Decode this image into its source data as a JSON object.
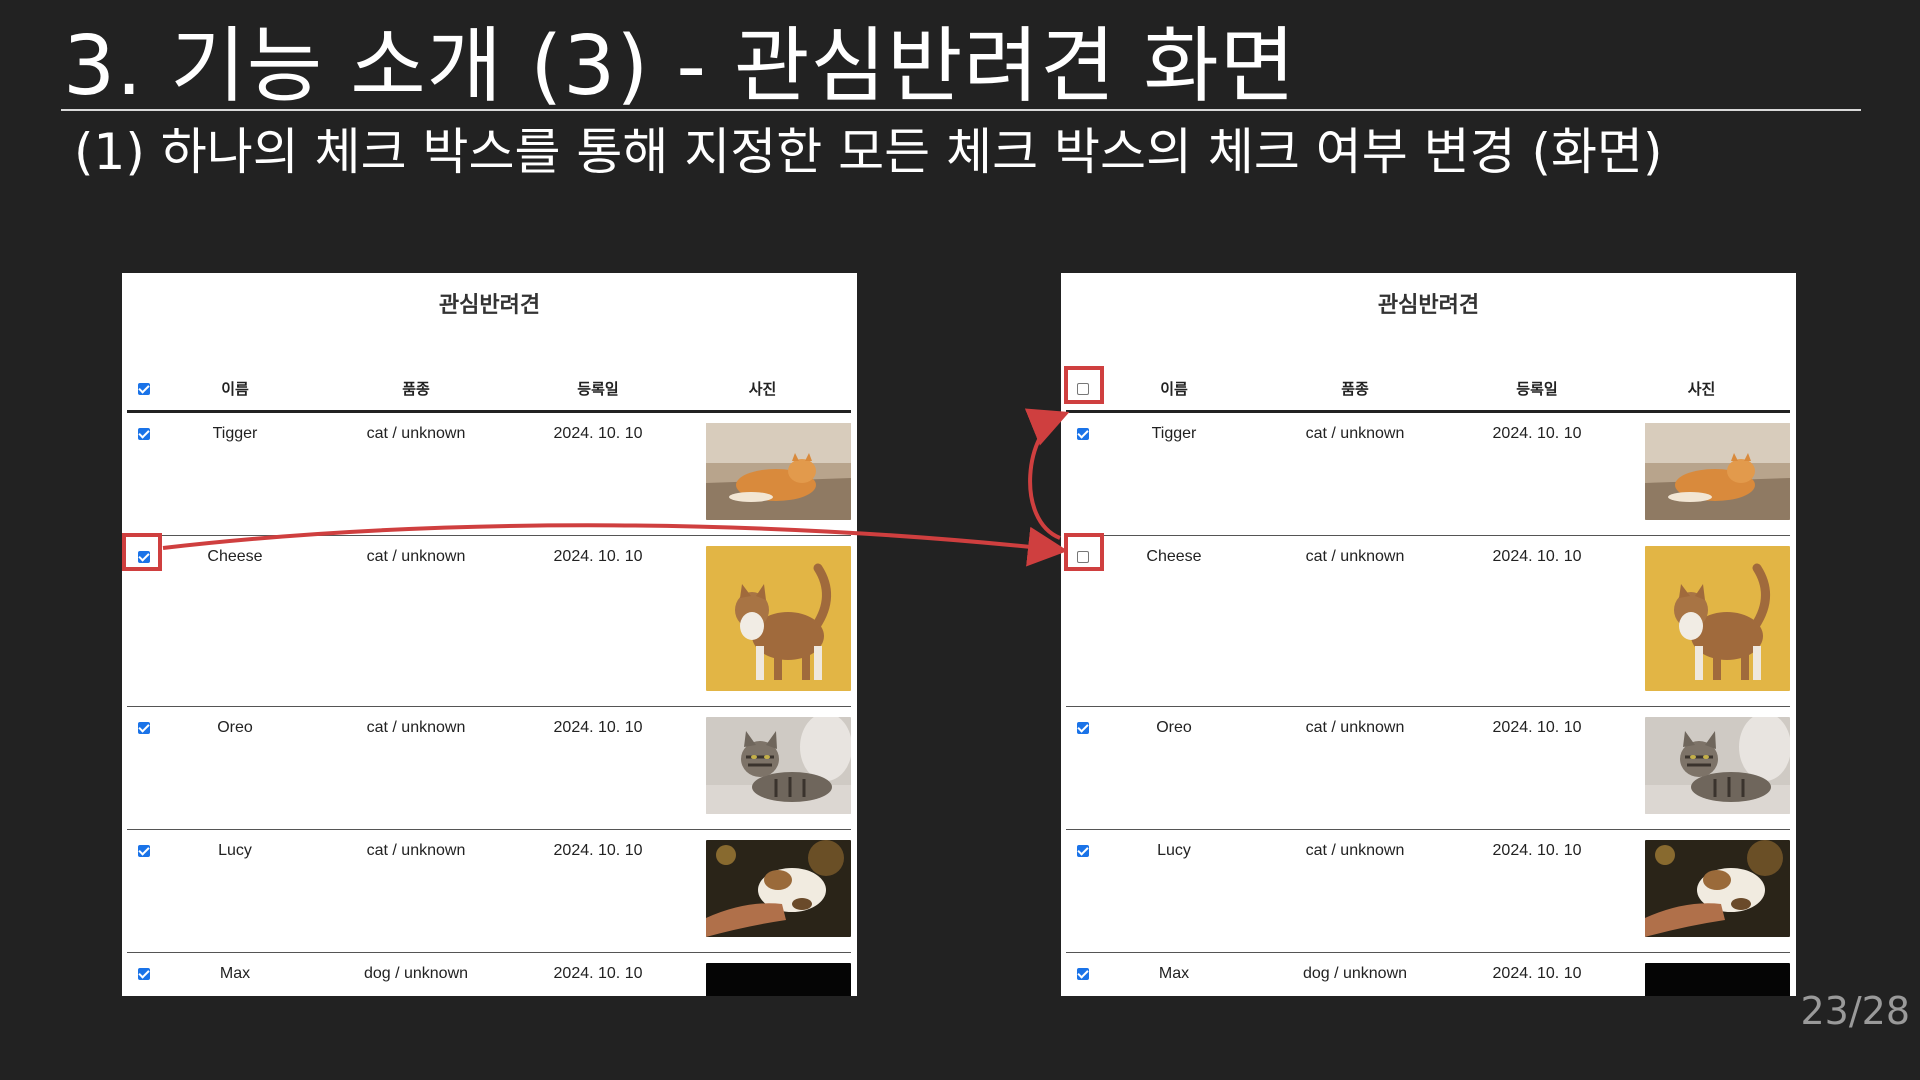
{
  "slide": {
    "title": "3. 기능 소개 (3) - 관심반려견 화면",
    "subtitle": "(1) 하나의 체크 박스를 통해 지정한 모든 체크 박스의 체크 여부 변경 (화면)",
    "page_number": "23/28"
  },
  "left_screen": {
    "title": "관심반려견",
    "headers": {
      "name": "이름",
      "breed": "품종",
      "date": "등록일",
      "photo": "사진"
    },
    "header_checked": true,
    "rows": [
      {
        "checked": true,
        "name": "Tigger",
        "breed": "cat / unknown",
        "date": "2024. 10. 10",
        "photo": "orange-cat-lying-photo"
      },
      {
        "checked": true,
        "name": "Cheese",
        "breed": "cat / unknown",
        "date": "2024. 10. 10",
        "photo": "orange-cat-standing-photo"
      },
      {
        "checked": true,
        "name": "Oreo",
        "breed": "cat / unknown",
        "date": "2024. 10. 10",
        "photo": "tabby-cat-on-sofa-photo"
      },
      {
        "checked": true,
        "name": "Lucy",
        "breed": "cat / unknown",
        "date": "2024. 10. 10",
        "photo": "cat-with-hand-photo"
      },
      {
        "checked": true,
        "name": "Max",
        "breed": "dog / unknown",
        "date": "2024. 10. 10",
        "photo": "dark-photo"
      }
    ]
  },
  "right_screen": {
    "title": "관심반려견",
    "headers": {
      "name": "이름",
      "breed": "품종",
      "date": "등록일",
      "photo": "사진"
    },
    "header_checked": false,
    "rows": [
      {
        "checked": true,
        "name": "Tigger",
        "breed": "cat / unknown",
        "date": "2024. 10. 10",
        "photo": "orange-cat-lying-photo"
      },
      {
        "checked": false,
        "name": "Cheese",
        "breed": "cat / unknown",
        "date": "2024. 10. 10",
        "photo": "orange-cat-standing-photo"
      },
      {
        "checked": true,
        "name": "Oreo",
        "breed": "cat / unknown",
        "date": "2024. 10. 10",
        "photo": "tabby-cat-on-sofa-photo"
      },
      {
        "checked": true,
        "name": "Lucy",
        "breed": "cat / unknown",
        "date": "2024. 10. 10",
        "photo": "cat-with-hand-photo"
      },
      {
        "checked": true,
        "name": "Max",
        "breed": "dog / unknown",
        "date": "2024. 10. 10",
        "photo": "dark-photo"
      }
    ]
  },
  "colors": {
    "background": "#222222",
    "highlight": "#cf3f3f",
    "checkbox": "#1a73e8"
  }
}
